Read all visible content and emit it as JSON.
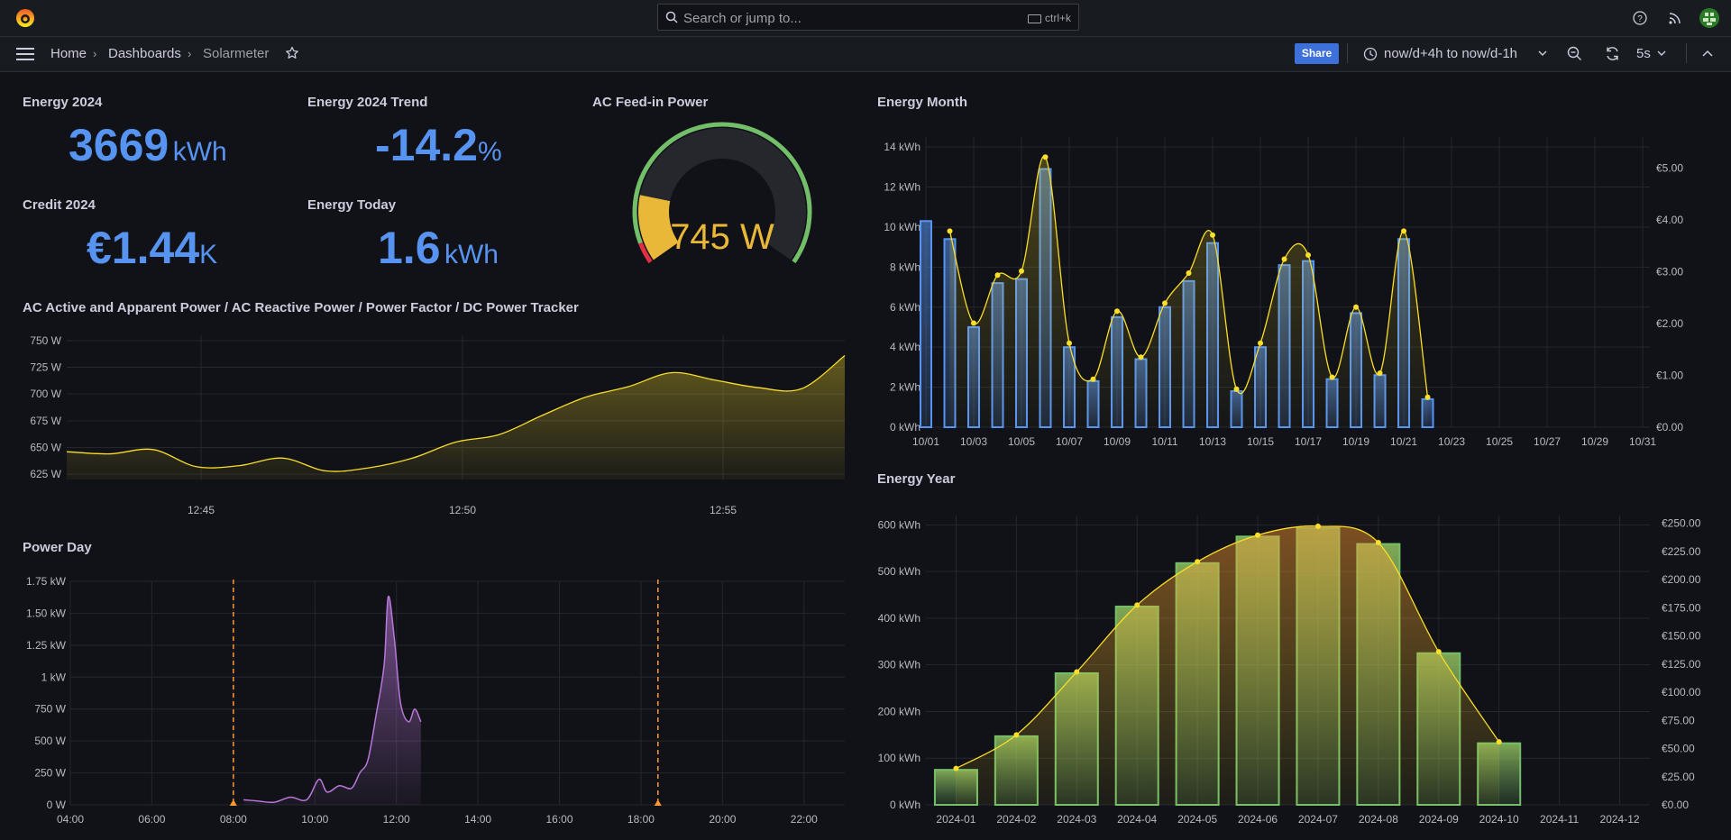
{
  "topbar": {
    "search_placeholder": "Search or jump to...",
    "search_shortcut": "ctrl+k"
  },
  "breadcrumb": {
    "home": "Home",
    "dashboards": "Dashboards",
    "current": "Solarmeter"
  },
  "toolbar": {
    "share_label": "Share",
    "time_range": "now/d+4h to now/d-1h",
    "refresh_interval": "5s"
  },
  "colors": {
    "accent": "#3d71d9",
    "stat_blue": "#5794f2",
    "yellow": "#fade2a",
    "green": "#73bf69",
    "purple": "#b877d9",
    "orange": "#ff9830"
  },
  "panels": {
    "energy_2024": {
      "title": "Energy 2024",
      "value": "3669",
      "unit": "kWh"
    },
    "energy_2024_trend": {
      "title": "Energy 2024 Trend",
      "value": "-14.2",
      "unit": "%"
    },
    "credit_2024": {
      "title": "Credit 2024",
      "value": "€1.44",
      "unit": "K"
    },
    "energy_today": {
      "title": "Energy Today",
      "value": "1.6",
      "unit": "kWh"
    },
    "ac_feed_in": {
      "title": "AC Feed-in Power",
      "value": "745 W"
    },
    "ac_power": {
      "title": "AC Active and Apparent Power / AC Reactive Power / Power Factor / DC Power Tracker"
    },
    "power_day": {
      "title": "Power Day"
    },
    "energy_month": {
      "title": "Energy Month"
    },
    "energy_year": {
      "title": "Energy Year"
    }
  },
  "chart_data": [
    {
      "type": "gauge",
      "value": 745,
      "unit": "W",
      "min": 0,
      "max": 4000
    },
    {
      "type": "area",
      "x_ticks": [
        "12:45",
        "12:50",
        "12:55"
      ],
      "y_ticks": [
        "625 W",
        "650 W",
        "675 W",
        "700 W",
        "725 W",
        "750 W"
      ],
      "ylim": [
        620,
        755
      ],
      "x_minutes": [
        0,
        1,
        2,
        3,
        4,
        5,
        6,
        7,
        8,
        9,
        10,
        11,
        12,
        13,
        14,
        15
      ],
      "values": [
        646,
        644,
        648,
        632,
        633,
        640,
        628,
        631,
        640,
        655,
        662,
        680,
        697,
        707,
        720,
        713,
        706,
        705,
        736
      ],
      "series_color": "#fade2a"
    },
    {
      "type": "area",
      "x_ticks": [
        "04:00",
        "06:00",
        "08:00",
        "10:00",
        "12:00",
        "14:00",
        "16:00",
        "18:00",
        "20:00",
        "22:00"
      ],
      "y_ticks": [
        "0 W",
        "250 W",
        "500 W",
        "750 W",
        "1 kW",
        "1.25 kW",
        "1.50 kW",
        "1.75 kW"
      ],
      "ylim": [
        0,
        1750
      ],
      "points": [
        [
          8.25,
          40
        ],
        [
          8.6,
          30
        ],
        [
          9.0,
          20
        ],
        [
          9.4,
          60
        ],
        [
          9.8,
          40
        ],
        [
          10.1,
          200
        ],
        [
          10.3,
          100
        ],
        [
          10.6,
          150
        ],
        [
          10.9,
          130
        ],
        [
          11.1,
          250
        ],
        [
          11.3,
          350
        ],
        [
          11.5,
          700
        ],
        [
          11.7,
          1100
        ],
        [
          11.8,
          1630
        ],
        [
          11.95,
          1300
        ],
        [
          12.1,
          800
        ],
        [
          12.3,
          650
        ],
        [
          12.45,
          750
        ],
        [
          12.6,
          650
        ]
      ],
      "annotations": [
        "08:00",
        "18:25"
      ],
      "series_color": "#b877d9"
    },
    {
      "type": "bar",
      "categories": [
        "10/01",
        "10/02",
        "10/03",
        "10/04",
        "10/05",
        "10/06",
        "10/07",
        "10/08",
        "10/09",
        "10/10",
        "10/11",
        "10/12",
        "10/13",
        "10/14",
        "10/15",
        "10/16",
        "10/17",
        "10/18",
        "10/19",
        "10/20",
        "10/21",
        "10/22"
      ],
      "x_ticks": [
        "10/01",
        "10/03",
        "10/05",
        "10/07",
        "10/09",
        "10/11",
        "10/13",
        "10/15",
        "10/17",
        "10/19",
        "10/21",
        "10/23",
        "10/25",
        "10/27",
        "10/29",
        "10/31"
      ],
      "values": [
        10.3,
        9.4,
        5.0,
        7.2,
        7.4,
        12.9,
        4.0,
        2.3,
        5.5,
        3.4,
        6.0,
        7.3,
        9.2,
        1.8,
        4.0,
        8.1,
        8.3,
        2.4,
        5.7,
        2.6,
        9.4,
        1.4
      ],
      "line_values": [
        null,
        9.8,
        5.2,
        7.6,
        7.8,
        13.5,
        4.2,
        2.4,
        5.8,
        3.5,
        6.2,
        7.7,
        9.6,
        1.9,
        4.2,
        8.4,
        8.6,
        2.5,
        6.0,
        2.7,
        9.8,
        1.5
      ],
      "y_ticks": [
        "0 kWh",
        "2 kWh",
        "4 kWh",
        "6 kWh",
        "8 kWh",
        "10 kWh",
        "12 kWh",
        "14 kWh"
      ],
      "ylim": [
        0,
        14.5
      ],
      "y2_ticks": [
        "€0.00",
        "€1.00",
        "€2.00",
        "€3.00",
        "€4.00",
        "€5.00"
      ],
      "bar_color": "#5794f2",
      "line_color": "#fade2a"
    },
    {
      "type": "bar",
      "categories": [
        "2024-01",
        "2024-02",
        "2024-03",
        "2024-04",
        "2024-05",
        "2024-06",
        "2024-07",
        "2024-08",
        "2024-09",
        "2024-10",
        "2024-11",
        "2024-12"
      ],
      "values": [
        75,
        147,
        282,
        425,
        518,
        575,
        593,
        559,
        325,
        132,
        null,
        null
      ],
      "line_values": [
        78,
        150,
        285,
        428,
        521,
        578,
        597,
        562,
        328,
        135,
        null,
        null
      ],
      "y_ticks": [
        "0 kWh",
        "100 kWh",
        "200 kWh",
        "300 kWh",
        "400 kWh",
        "500 kWh",
        "600 kWh"
      ],
      "ylim": [
        0,
        620
      ],
      "y2_ticks": [
        "€0.00",
        "€25.00",
        "€50.00",
        "€75.00",
        "€100.00",
        "€125.00",
        "€150.00",
        "€175.00",
        "€200.00",
        "€225.00",
        "€250.00"
      ],
      "bar_color": "#73bf69",
      "line_color": "#fade2a"
    }
  ]
}
